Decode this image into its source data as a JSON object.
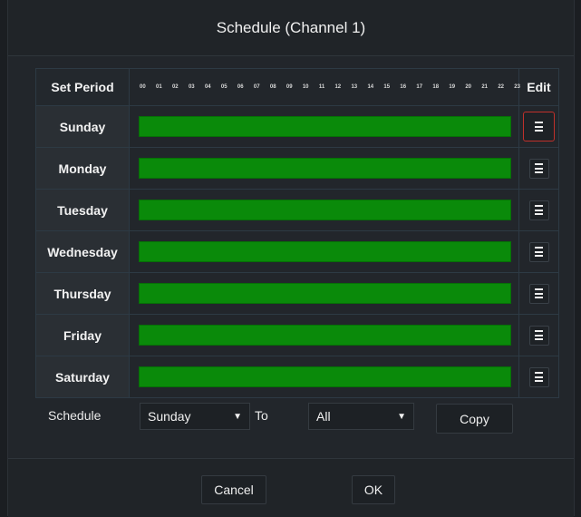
{
  "dialog": {
    "title": "Schedule (Channel 1)"
  },
  "grid": {
    "period_header": "Set Period",
    "edit_header": "Edit",
    "hours": [
      "00",
      "01",
      "02",
      "03",
      "04",
      "05",
      "06",
      "07",
      "08",
      "09",
      "10",
      "11",
      "12",
      "13",
      "14",
      "15",
      "16",
      "17",
      "18",
      "19",
      "20",
      "21",
      "22",
      "23"
    ],
    "days": [
      "Sunday",
      "Monday",
      "Tuesday",
      "Wednesday",
      "Thursday",
      "Friday",
      "Saturday"
    ],
    "schedule_color": "#0a8a0a",
    "selected_edit_day": "Sunday"
  },
  "schedule_copy": {
    "label": "Schedule",
    "from_value": "Sunday",
    "to_label": "To",
    "to_value": "All",
    "copy_label": "Copy"
  },
  "footer": {
    "cancel_label": "Cancel",
    "ok_label": "OK"
  },
  "icons": {
    "edit": "list-icon",
    "dropdown": "caret-down-icon"
  }
}
